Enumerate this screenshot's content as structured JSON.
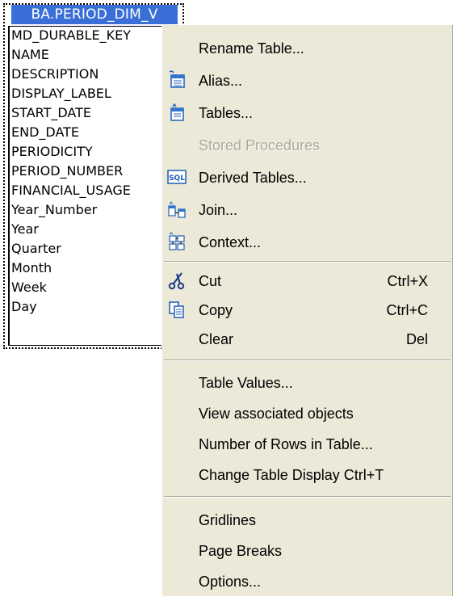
{
  "table": {
    "title": "BA.PERIOD_DIM_V",
    "columns": [
      "MD_DURABLE_KEY",
      "NAME",
      "DESCRIPTION",
      "DISPLAY_LABEL",
      "START_DATE",
      "END_DATE",
      "PERIODICITY",
      "PERIOD_NUMBER",
      "FINANCIAL_USAGE",
      "Year_Number",
      "Year",
      "Quarter",
      "Month",
      "Week",
      "Day"
    ]
  },
  "menu": {
    "items": [
      {
        "label": "Rename Table...",
        "shortcut": "",
        "icon": "",
        "disabled": false
      },
      {
        "label": "Alias...",
        "shortcut": "",
        "icon": "alias-icon",
        "disabled": false
      },
      {
        "label": "Tables...",
        "shortcut": "",
        "icon": "tables-icon",
        "disabled": false
      },
      {
        "label": "Stored Procedures",
        "shortcut": "",
        "icon": "",
        "disabled": true
      },
      {
        "label": "Derived Tables...",
        "shortcut": "",
        "icon": "sql-icon",
        "disabled": false
      },
      {
        "label": "Join...",
        "shortcut": "",
        "icon": "join-icon",
        "disabled": false
      },
      {
        "label": "Context...",
        "shortcut": "",
        "icon": "context-icon",
        "disabled": false
      },
      {
        "label": "Cut",
        "shortcut": "Ctrl+X",
        "icon": "scissors-icon",
        "disabled": false
      },
      {
        "label": "Copy",
        "shortcut": "Ctrl+C",
        "icon": "copy-icon",
        "disabled": false
      },
      {
        "label": "Clear",
        "shortcut": "Del",
        "icon": "",
        "disabled": false
      },
      {
        "label": "Table Values...",
        "shortcut": "",
        "icon": "",
        "disabled": false
      },
      {
        "label": "View associated objects",
        "shortcut": "",
        "icon": "",
        "disabled": false
      },
      {
        "label": "Number of Rows in Table...",
        "shortcut": "",
        "icon": "",
        "disabled": false
      },
      {
        "label": "Change Table Display Ctrl+T",
        "shortcut": "",
        "icon": "",
        "disabled": false
      },
      {
        "label": "Gridlines",
        "shortcut": "",
        "icon": "",
        "disabled": false
      },
      {
        "label": "Page Breaks",
        "shortcut": "",
        "icon": "",
        "disabled": false
      },
      {
        "label": "Options...",
        "shortcut": "",
        "icon": "",
        "disabled": false
      }
    ]
  },
  "colors": {
    "header_bg": "#3a6fd8",
    "menu_bg": "#ece9d8",
    "disabled_text": "#aca899"
  }
}
